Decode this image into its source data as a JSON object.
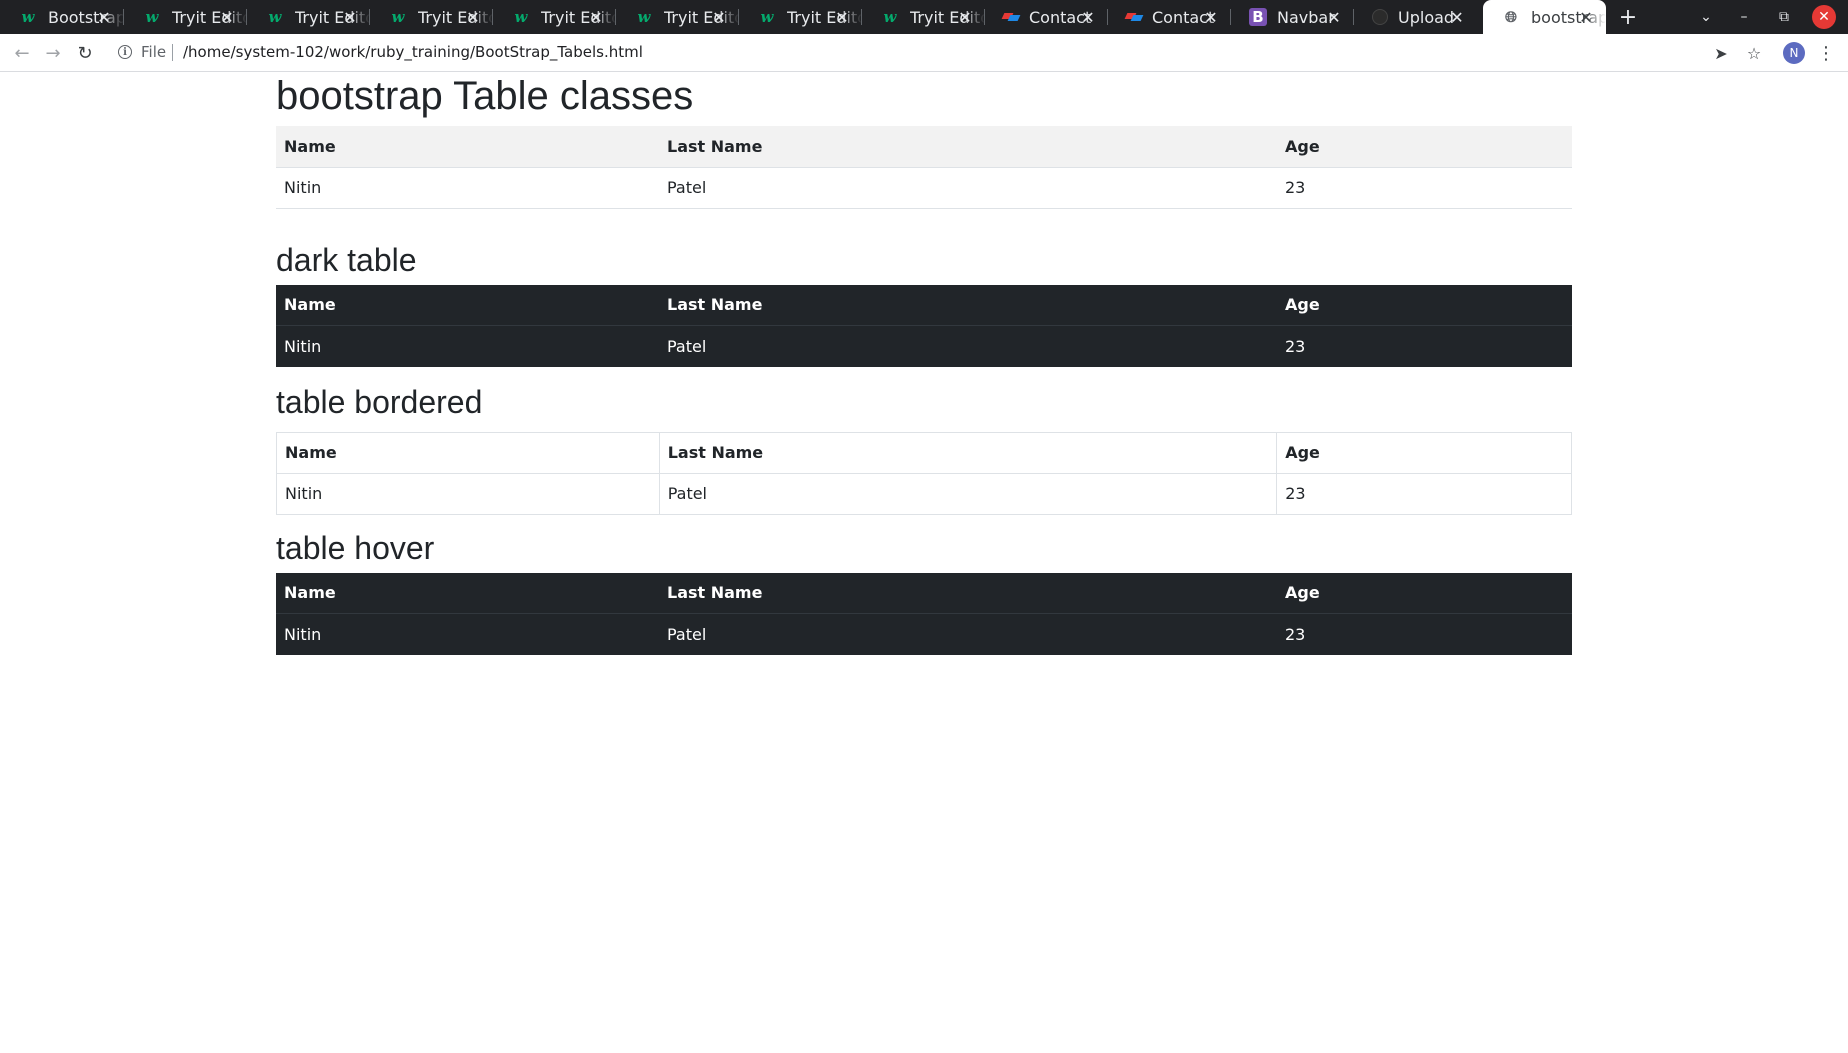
{
  "browser": {
    "tabs": [
      {
        "label": "Bootstrap",
        "favicon": "w3schools-icon"
      },
      {
        "label": "Tryit Editor",
        "favicon": "w3schools-icon"
      },
      {
        "label": "Tryit Editor",
        "favicon": "w3schools-icon"
      },
      {
        "label": "Tryit Editor",
        "favicon": "w3schools-icon"
      },
      {
        "label": "Tryit Editor",
        "favicon": "w3schools-icon"
      },
      {
        "label": "Tryit Editor",
        "favicon": "w3schools-icon"
      },
      {
        "label": "Tryit Editor",
        "favicon": "w3schools-icon"
      },
      {
        "label": "Tryit Editor",
        "favicon": "w3schools-icon"
      },
      {
        "label": "Contact",
        "favicon": "contact-icon"
      },
      {
        "label": "Contact",
        "favicon": "contact-icon"
      },
      {
        "label": "Navbar",
        "favicon": "bootstrap-icon"
      },
      {
        "label": "Upload",
        "favicon": "github-icon"
      },
      {
        "label": "bootstrap",
        "favicon": "globe-icon",
        "active": true
      }
    ],
    "address": {
      "scheme_label": "File",
      "url": "/home/system-102/work/ruby_training/BootStrap_Tabels.html"
    },
    "profile_initial": "N"
  },
  "page": {
    "title": "bootstrap Table classes",
    "sections": {
      "dark": "dark table",
      "bordered": "table bordered",
      "hover": "table hover"
    },
    "columns": [
      "Name",
      "Last Name",
      "Age"
    ],
    "row": [
      "Nitin",
      "Patel",
      "23"
    ]
  },
  "colors": {
    "tabstrip": "#202124",
    "dark_table": "#212529",
    "light_header": "#f2f2f2",
    "border": "#dee2e6"
  }
}
